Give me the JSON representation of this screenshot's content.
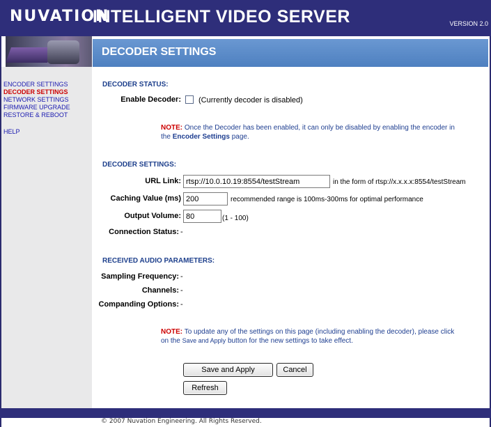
{
  "header": {
    "brand": "NUVATION",
    "title": "INTELLIGENT VIDEO SERVER",
    "version": "VERSION 2.0"
  },
  "banner": {
    "title": "DECODER SETTINGS"
  },
  "nav": {
    "items": [
      {
        "label": "ENCODER SETTINGS"
      },
      {
        "label": "DECODER SETTINGS"
      },
      {
        "label": "NETWORK SETTINGS"
      },
      {
        "label": "FIRMWARE UPGRADE"
      },
      {
        "label": "RESTORE & REBOOT"
      }
    ],
    "help": "HELP"
  },
  "decoder_status": {
    "heading": "DECODER STATUS:",
    "enable_label": "Enable Decoder:",
    "enable_checked": false,
    "enable_status": "(Currently decoder is disabled)",
    "note_label": "NOTE:",
    "note_line1": "Once the Decoder has been enabled, it can only be disabled by enabling the encoder in",
    "note_pre": "the",
    "note_link": "Encoder Settings",
    "note_post": "page."
  },
  "decoder_settings": {
    "heading": "DECODER SETTINGS:",
    "url_label": "URL Link:",
    "url_value": "rtsp://10.0.10.19:8554/testStream",
    "url_hint": "in the form of rtsp://x.x.x.x:8554/testStream",
    "caching_label": "Caching Value (ms)",
    "caching_value": "200",
    "caching_hint": "recommended range is 100ms-300ms for optimal performance",
    "volume_label": "Output Volume:",
    "volume_value": "80",
    "volume_hint": "(1 - 100)",
    "connection_label": "Connection Status:",
    "connection_value": "-"
  },
  "audio": {
    "heading": "RECEIVED AUDIO PARAMETERS:",
    "sampling_label": "Sampling Frequency:",
    "sampling_value": "-",
    "channels_label": "Channels:",
    "channels_value": "-",
    "companding_label": "Companding Options:",
    "companding_value": "-"
  },
  "update_note": {
    "label": "NOTE:",
    "line1": "To update any of the settings on this page (including enabling the decoder), please click",
    "line2_pre": "on the",
    "line2_small": "Save and Apply",
    "line2_post": "button for the new settings to take effect."
  },
  "buttons": {
    "save": "Save and Apply",
    "cancel": "Cancel",
    "refresh": "Refresh"
  },
  "footer": {
    "text": "© 2007 Nuvation Engineering. All Rights Reserved."
  },
  "colors": {
    "header_bg": "#2e2e7a",
    "banner_bg": "#5a8ac8",
    "sidebar_bg": "#e9e9ea",
    "nav_link": "#1a1ab0",
    "nav_active": "#cc0000",
    "section_heading": "#1d3f8c",
    "note_label": "#cc0000"
  }
}
